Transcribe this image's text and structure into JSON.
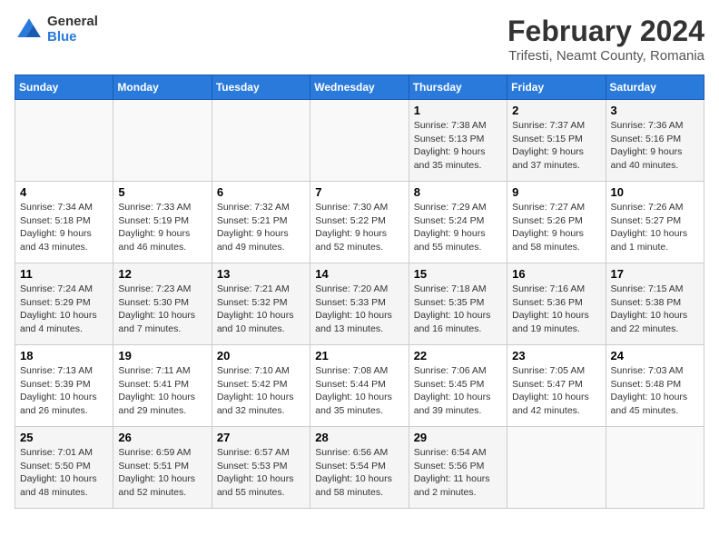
{
  "header": {
    "logo_general": "General",
    "logo_blue": "Blue",
    "main_title": "February 2024",
    "subtitle": "Trifesti, Neamt County, Romania"
  },
  "weekdays": [
    "Sunday",
    "Monday",
    "Tuesday",
    "Wednesday",
    "Thursday",
    "Friday",
    "Saturday"
  ],
  "weeks": [
    [
      {
        "day": "",
        "info": ""
      },
      {
        "day": "",
        "info": ""
      },
      {
        "day": "",
        "info": ""
      },
      {
        "day": "",
        "info": ""
      },
      {
        "day": "1",
        "info": "Sunrise: 7:38 AM\nSunset: 5:13 PM\nDaylight: 9 hours\nand 35 minutes."
      },
      {
        "day": "2",
        "info": "Sunrise: 7:37 AM\nSunset: 5:15 PM\nDaylight: 9 hours\nand 37 minutes."
      },
      {
        "day": "3",
        "info": "Sunrise: 7:36 AM\nSunset: 5:16 PM\nDaylight: 9 hours\nand 40 minutes."
      }
    ],
    [
      {
        "day": "4",
        "info": "Sunrise: 7:34 AM\nSunset: 5:18 PM\nDaylight: 9 hours\nand 43 minutes."
      },
      {
        "day": "5",
        "info": "Sunrise: 7:33 AM\nSunset: 5:19 PM\nDaylight: 9 hours\nand 46 minutes."
      },
      {
        "day": "6",
        "info": "Sunrise: 7:32 AM\nSunset: 5:21 PM\nDaylight: 9 hours\nand 49 minutes."
      },
      {
        "day": "7",
        "info": "Sunrise: 7:30 AM\nSunset: 5:22 PM\nDaylight: 9 hours\nand 52 minutes."
      },
      {
        "day": "8",
        "info": "Sunrise: 7:29 AM\nSunset: 5:24 PM\nDaylight: 9 hours\nand 55 minutes."
      },
      {
        "day": "9",
        "info": "Sunrise: 7:27 AM\nSunset: 5:26 PM\nDaylight: 9 hours\nand 58 minutes."
      },
      {
        "day": "10",
        "info": "Sunrise: 7:26 AM\nSunset: 5:27 PM\nDaylight: 10 hours\nand 1 minute."
      }
    ],
    [
      {
        "day": "11",
        "info": "Sunrise: 7:24 AM\nSunset: 5:29 PM\nDaylight: 10 hours\nand 4 minutes."
      },
      {
        "day": "12",
        "info": "Sunrise: 7:23 AM\nSunset: 5:30 PM\nDaylight: 10 hours\nand 7 minutes."
      },
      {
        "day": "13",
        "info": "Sunrise: 7:21 AM\nSunset: 5:32 PM\nDaylight: 10 hours\nand 10 minutes."
      },
      {
        "day": "14",
        "info": "Sunrise: 7:20 AM\nSunset: 5:33 PM\nDaylight: 10 hours\nand 13 minutes."
      },
      {
        "day": "15",
        "info": "Sunrise: 7:18 AM\nSunset: 5:35 PM\nDaylight: 10 hours\nand 16 minutes."
      },
      {
        "day": "16",
        "info": "Sunrise: 7:16 AM\nSunset: 5:36 PM\nDaylight: 10 hours\nand 19 minutes."
      },
      {
        "day": "17",
        "info": "Sunrise: 7:15 AM\nSunset: 5:38 PM\nDaylight: 10 hours\nand 22 minutes."
      }
    ],
    [
      {
        "day": "18",
        "info": "Sunrise: 7:13 AM\nSunset: 5:39 PM\nDaylight: 10 hours\nand 26 minutes."
      },
      {
        "day": "19",
        "info": "Sunrise: 7:11 AM\nSunset: 5:41 PM\nDaylight: 10 hours\nand 29 minutes."
      },
      {
        "day": "20",
        "info": "Sunrise: 7:10 AM\nSunset: 5:42 PM\nDaylight: 10 hours\nand 32 minutes."
      },
      {
        "day": "21",
        "info": "Sunrise: 7:08 AM\nSunset: 5:44 PM\nDaylight: 10 hours\nand 35 minutes."
      },
      {
        "day": "22",
        "info": "Sunrise: 7:06 AM\nSunset: 5:45 PM\nDaylight: 10 hours\nand 39 minutes."
      },
      {
        "day": "23",
        "info": "Sunrise: 7:05 AM\nSunset: 5:47 PM\nDaylight: 10 hours\nand 42 minutes."
      },
      {
        "day": "24",
        "info": "Sunrise: 7:03 AM\nSunset: 5:48 PM\nDaylight: 10 hours\nand 45 minutes."
      }
    ],
    [
      {
        "day": "25",
        "info": "Sunrise: 7:01 AM\nSunset: 5:50 PM\nDaylight: 10 hours\nand 48 minutes."
      },
      {
        "day": "26",
        "info": "Sunrise: 6:59 AM\nSunset: 5:51 PM\nDaylight: 10 hours\nand 52 minutes."
      },
      {
        "day": "27",
        "info": "Sunrise: 6:57 AM\nSunset: 5:53 PM\nDaylight: 10 hours\nand 55 minutes."
      },
      {
        "day": "28",
        "info": "Sunrise: 6:56 AM\nSunset: 5:54 PM\nDaylight: 10 hours\nand 58 minutes."
      },
      {
        "day": "29",
        "info": "Sunrise: 6:54 AM\nSunset: 5:56 PM\nDaylight: 11 hours\nand 2 minutes."
      },
      {
        "day": "",
        "info": ""
      },
      {
        "day": "",
        "info": ""
      }
    ]
  ]
}
